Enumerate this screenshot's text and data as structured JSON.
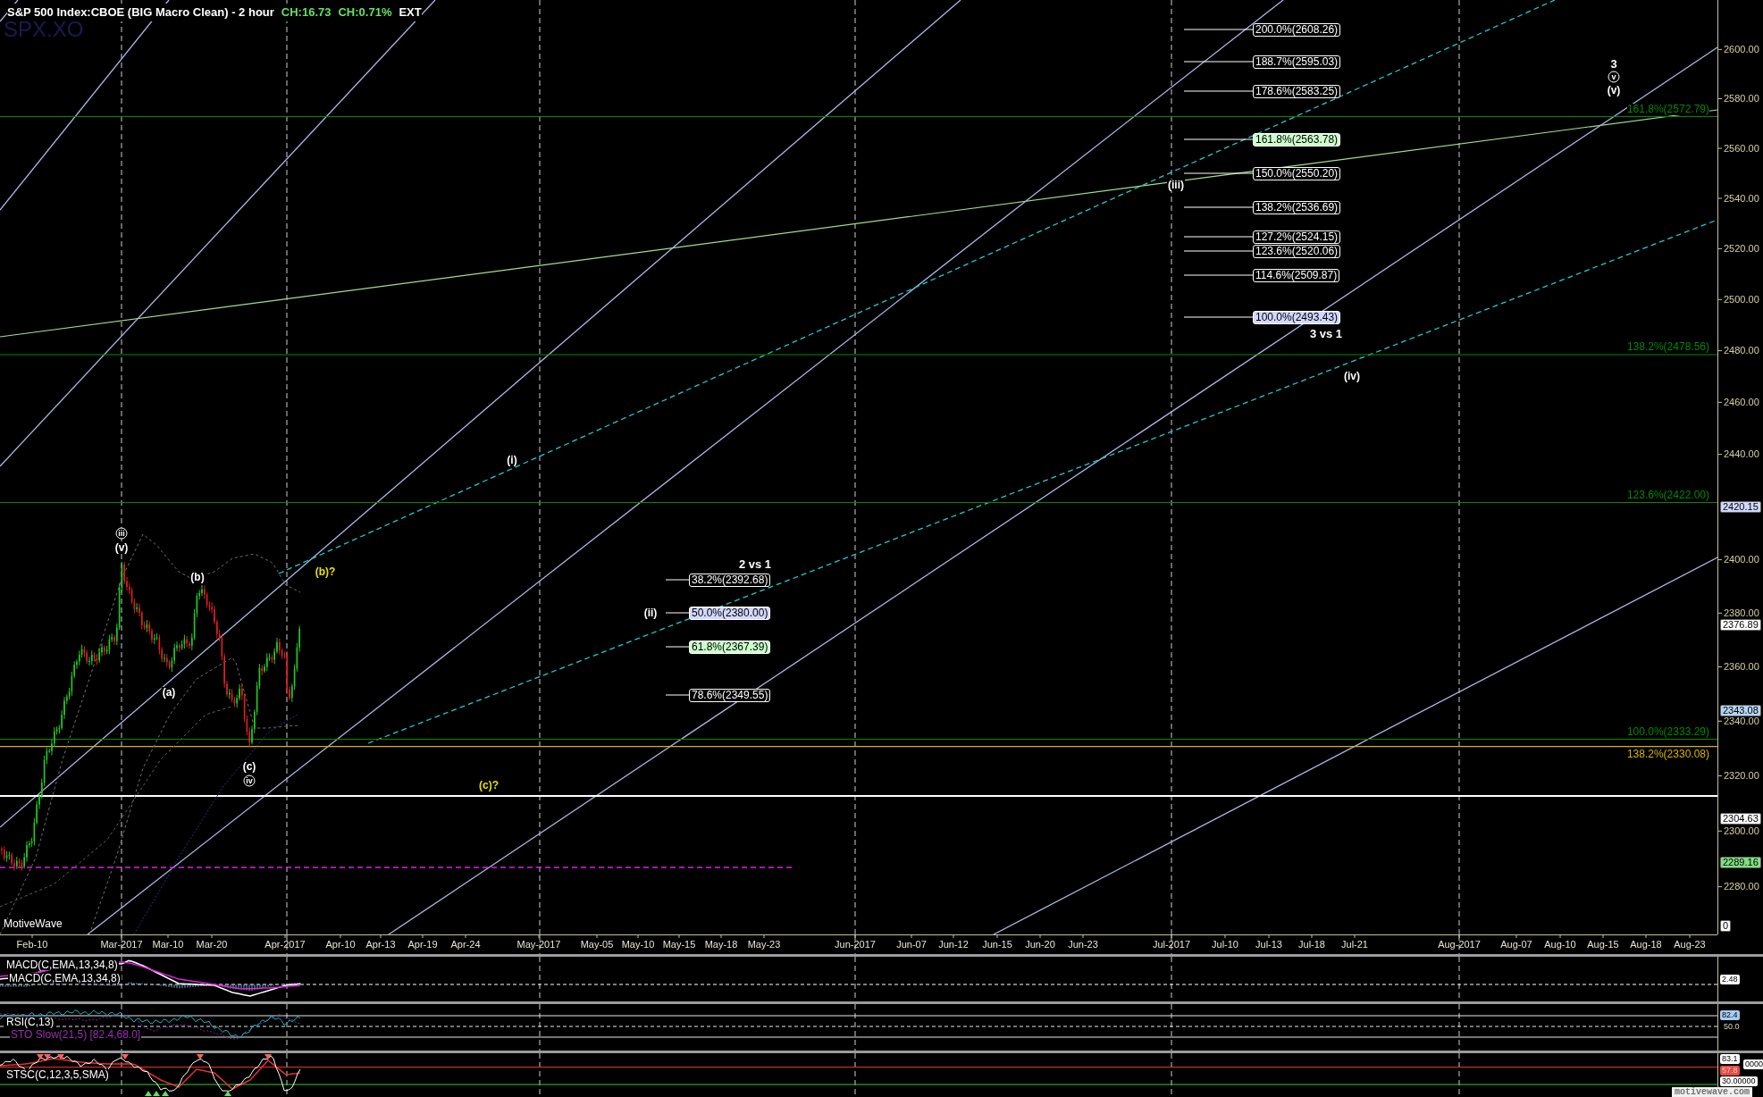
{
  "header": {
    "title": "S&P 500 Index:CBOE (BIG Macro Clean) - 2 hour",
    "change": "CH:16.73",
    "change_percent": "CH:0.71%",
    "session": "EXT",
    "symbol": "SPX.XO"
  },
  "price_chart": {
    "brand": "MotiveWave",
    "projections": [
      {
        "title": "3 vs 1",
        "levels": [
          {
            "text": "200.0%(2608.26)",
            "color": "#000000"
          },
          {
            "text": "188.7%(2595.03)",
            "color": "#000000"
          },
          {
            "text": "178.6%(2583.25)",
            "color": "#000000"
          },
          {
            "text": "161.8%(2563.78)",
            "color": "#ccffcc"
          },
          {
            "text": "150.0%(2550.20)",
            "color": "#000000"
          },
          {
            "text": "138.2%(2536.69)",
            "color": "#000000"
          },
          {
            "text": "127.2%(2524.15)",
            "color": "#000000"
          },
          {
            "text": "123.6%(2520.06)",
            "color": "#000000"
          },
          {
            "text": "114.6%(2509.87)",
            "color": "#000000"
          },
          {
            "text": "100.0%(2493.43)",
            "color": "#d4d8ff"
          }
        ]
      },
      {
        "title": "2 vs 1",
        "levels": [
          {
            "text": "38.2%(2392.68)",
            "color": "#000000"
          },
          {
            "text": "50.0%(2380.00)",
            "color": "#d4d8ff"
          },
          {
            "text": "61.8%(2367.39)",
            "color": "#ccffcc"
          },
          {
            "text": "78.6%(2349.55)",
            "color": "#000000"
          }
        ]
      }
    ],
    "level_lines": [
      {
        "text": "161.8%(2572.79)",
        "color": "#008a00"
      },
      {
        "text": "138.2%(2478.56)",
        "color": "#008a00"
      },
      {
        "text": "123.6%(2422.00)",
        "color": "#008a00"
      },
      {
        "text": "100.0%(2333.29)",
        "color": "#008a00"
      },
      {
        "text": "138.2%(2330.08)",
        "color": "#d4b400"
      }
    ],
    "wave_labels": [
      {
        "text": "iii",
        "kind": "circled",
        "color": "#ffffff"
      },
      {
        "text": "(v)",
        "kind": "plain",
        "color": "#ffffff"
      },
      {
        "text": "(b)",
        "kind": "plain",
        "color": "#ffffff"
      },
      {
        "text": "(a)",
        "kind": "plain",
        "color": "#ffffff"
      },
      {
        "text": "(c)",
        "kind": "plain",
        "color": "#ffffff"
      },
      {
        "text": "iv",
        "kind": "circled",
        "color": "#ffffff"
      },
      {
        "text": "(b)?",
        "kind": "plain",
        "color": "#e8e000"
      },
      {
        "text": "(c)?",
        "kind": "plain",
        "color": "#e8e000"
      },
      {
        "text": "(i)",
        "kind": "plain",
        "color": "#ffffff"
      },
      {
        "text": "(ii)",
        "kind": "plain",
        "color": "#ffffff"
      },
      {
        "text": "(iii)",
        "kind": "plain",
        "color": "#ffffff"
      },
      {
        "text": "(iv)",
        "kind": "plain",
        "color": "#ffffff"
      },
      {
        "text": "3",
        "kind": "major",
        "color": "#ffffff"
      },
      {
        "text": "v",
        "kind": "circled",
        "color": "#ffffff"
      },
      {
        "text": "(v)",
        "kind": "plain",
        "color": "#ffffff"
      }
    ],
    "price_axis": [
      "2600.00",
      "2580.00",
      "2560.00",
      "2540.00",
      "2520.00",
      "2500.00",
      "2480.00",
      "2460.00",
      "2440.00",
      "2400.00",
      "2380.00",
      "2360.00",
      "2340.00",
      "2320.00",
      "2300.00",
      "2280.00"
    ],
    "price_tags": [
      {
        "text": "2420.15",
        "color": "#d0d8ff"
      },
      {
        "text": "2376.89",
        "color": "#ffffff"
      },
      {
        "text": "2343.08",
        "color": "#b4d4f4"
      },
      {
        "text": "2304.63",
        "color": "#ffffff"
      },
      {
        "text": "2289.16",
        "color": "#80e080"
      },
      {
        "text": "0",
        "color": "#ffffff"
      }
    ],
    "date_axis": [
      "Feb-10",
      "Mar-2017",
      "Mar-10",
      "Mar-20",
      "Apr-2017",
      "Apr-10",
      "Apr-13",
      "Apr-19",
      "Apr-24",
      "May-2017",
      "May-05",
      "May-10",
      "May-15",
      "May-18",
      "May-23",
      "Jun-2017",
      "Jun-07",
      "Jun-12",
      "Jun-15",
      "Jun-20",
      "Jun-23",
      "Jul-2017",
      "Jul-10",
      "Jul-13",
      "Jul-18",
      "Jul-21",
      "Aug-2017",
      "Aug-07",
      "Aug-10",
      "Aug-15",
      "Aug-18",
      "Aug-23"
    ]
  },
  "indicators": [
    {
      "kind": "macd",
      "labels": [
        {
          "text": "MACD(C,EMA,13,34,8)",
          "color": "#ffffff"
        },
        {
          "text": "MACD(C,EMA,13,34,8)",
          "color": "#ffffff"
        }
      ],
      "tags": [
        {
          "text": "2.48",
          "color": "#ffffff"
        }
      ]
    },
    {
      "kind": "rsi",
      "labels": [
        {
          "text": "RSI(C,13)",
          "color": "#ffffff"
        },
        {
          "text": "STO Slow(21,5) [82.4,68.0]",
          "color": "#9a30b0"
        }
      ],
      "tags": [
        {
          "text": "82.4",
          "color": "#a8ccf4"
        },
        {
          "text": "50.0",
          "color": "#000000"
        }
      ]
    },
    {
      "kind": "stsc",
      "labels": [
        {
          "text": "STSC(C,12,3,5,SMA)",
          "color": "#ffffff"
        }
      ],
      "tags": [
        {
          "text": "83.1",
          "color": "#ffffff"
        },
        {
          "text": "0000",
          "color": "#ffffff"
        },
        {
          "text": "57.8",
          "color": "#e84848"
        },
        {
          "text": "30.00000",
          "color": "#ffffff"
        }
      ]
    }
  ],
  "footer_brand": "motivewave.com"
}
